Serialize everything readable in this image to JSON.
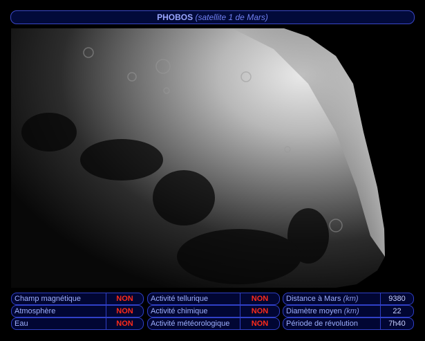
{
  "header": {
    "name": "PHOBOS",
    "subtitle": "(satellite 1 de Mars)"
  },
  "photo": {
    "subject": "Phobos"
  },
  "properties": {
    "col1": [
      {
        "label": "Champ magnétique",
        "value": "NON"
      },
      {
        "label": "Atmosphère",
        "value": "NON"
      },
      {
        "label": "Eau",
        "value": "NON"
      }
    ],
    "col2": [
      {
        "label": "Activité tellurique",
        "value": "NON"
      },
      {
        "label": "Activité chimique",
        "value": "NON"
      },
      {
        "label": "Activité météorologique",
        "value": "NON"
      }
    ],
    "col3": [
      {
        "label": "Distance à Mars",
        "unit": "(km)",
        "value": "9380"
      },
      {
        "label": "Diamètre moyen",
        "unit": "(km)",
        "value": "22"
      },
      {
        "label": "Période de révolution",
        "unit": "",
        "value": "7h40"
      }
    ]
  },
  "colors": {
    "border": "#3040c8",
    "panel": "#010633",
    "negative": "#ff2b1a",
    "label": "#9fb0ff"
  }
}
